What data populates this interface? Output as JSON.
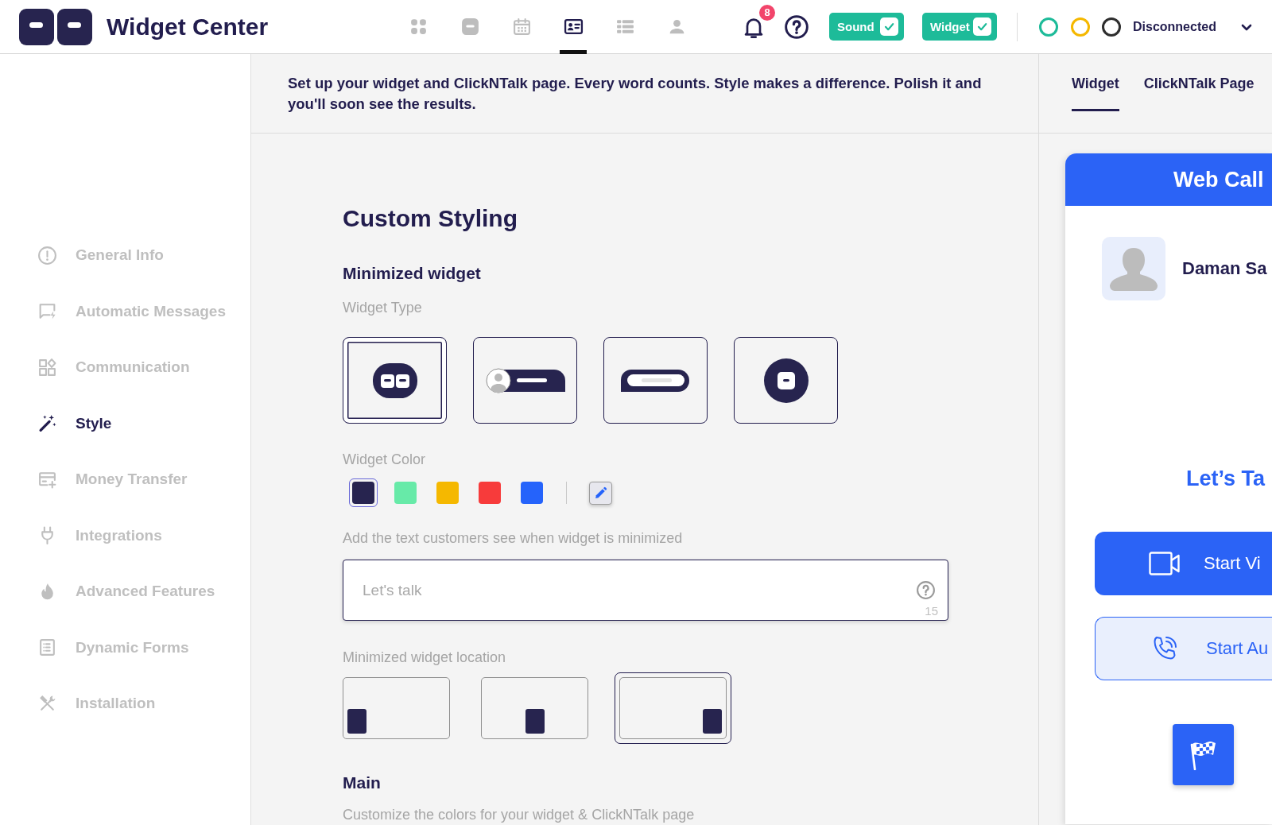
{
  "header": {
    "title": "Widget Center",
    "nav": [
      {
        "kind": "grid",
        "selected": false
      },
      {
        "kind": "logo",
        "selected": false
      },
      {
        "kind": "calendar",
        "selected": false
      },
      {
        "kind": "contact-card",
        "selected": true
      },
      {
        "kind": "rows",
        "selected": false
      },
      {
        "kind": "person",
        "selected": false
      }
    ],
    "notifications": "8",
    "toggles": [
      {
        "label": "Sound",
        "checked": true
      },
      {
        "label": "Widget",
        "checked": true
      }
    ],
    "status_dots": [
      {
        "color": "#1dbb99"
      },
      {
        "color": "#f5b800"
      },
      {
        "color": "#2e2e2e"
      }
    ],
    "status": "Disconnected"
  },
  "sidebar": {
    "items": [
      {
        "kind": "info",
        "label": "General Info",
        "selected": false
      },
      {
        "kind": "message",
        "label": "Automatic Messages",
        "selected": false
      },
      {
        "kind": "widgets",
        "label": "Communication",
        "selected": false
      },
      {
        "kind": "wand",
        "label": "Style",
        "selected": true
      },
      {
        "kind": "payment",
        "label": "Money Transfer",
        "selected": false
      },
      {
        "kind": "plug",
        "label": "Integrations",
        "selected": false
      },
      {
        "kind": "flame",
        "label": "Advanced Features",
        "selected": false
      },
      {
        "kind": "form",
        "label": "Dynamic Forms",
        "selected": false
      },
      {
        "kind": "tools",
        "label": "Installation",
        "selected": false
      }
    ]
  },
  "intro": "Set up your widget and ClickNTalk page. Every word counts. Style makes a difference. Polish it and you'll soon see the results.",
  "styling": {
    "title": "Custom Styling",
    "minimized": {
      "heading": "Minimized widget",
      "type_label": "Widget Type",
      "types": [
        {
          "kind": "logo",
          "selected": true
        },
        {
          "kind": "avatar-bar",
          "selected": false
        },
        {
          "kind": "pill",
          "selected": false
        },
        {
          "kind": "circle",
          "selected": false
        }
      ],
      "color_label": "Widget Color",
      "colors": [
        {
          "color": "#27244f",
          "selected": true
        },
        {
          "color": "#67eaa8",
          "selected": false
        },
        {
          "color": "#f5b800",
          "selected": false
        },
        {
          "color": "#f73b3b",
          "selected": false
        },
        {
          "color": "#2563fb",
          "selected": false
        }
      ],
      "text_label": "Add the text customers see when widget is minimized",
      "text_field": {
        "placeholder": "Let's talk",
        "counter": "15"
      },
      "location_label": "Minimized widget location",
      "locations": [
        {
          "kind": "left",
          "selected": false
        },
        {
          "kind": "center",
          "selected": false
        },
        {
          "kind": "right",
          "selected": true
        }
      ]
    },
    "main": {
      "heading": "Main",
      "description": "Customize the colors for your widget & ClickNTalk page"
    }
  },
  "preview": {
    "tabs": [
      {
        "label": "Widget",
        "selected": true
      },
      {
        "label": "ClickNTalk Page",
        "selected": false
      }
    ],
    "card": {
      "title": "Web Call",
      "agent_name": "Daman Sa",
      "greeting": "Let’s Ta",
      "buttons": [
        {
          "kind": "video",
          "label": "Start Vi"
        },
        {
          "kind": "audio",
          "label": "Start Au"
        }
      ]
    }
  }
}
